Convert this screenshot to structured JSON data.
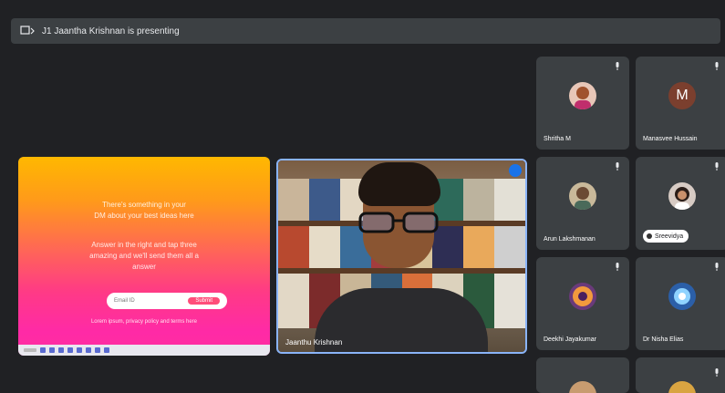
{
  "banner": {
    "text": "J1 Jaantha Krishnan is presenting"
  },
  "presentation": {
    "lines": [
      "There's something in your",
      "DM about your best ideas here",
      "Answer in the right and tap three",
      "amazing and we'll send them all a",
      "answer"
    ],
    "input_placeholder": "Email ID",
    "submit_label": "Submit",
    "footer": "Lorem ipsum, privacy policy and terms here"
  },
  "camera": {
    "name": "Jaanthu Krishnan"
  },
  "participants": [
    {
      "name": "Shritha M",
      "avatar_color": "#e8c7b8"
    },
    {
      "name": "Manasvee Hussain",
      "initial": "M",
      "avatar_color": "#7b3f2e"
    },
    {
      "name": "Arun Lakshmanan",
      "avatar_color": "#c9b99a"
    },
    {
      "name": "Sreevidya",
      "avatar_color": "#d7cbc4"
    },
    {
      "name": "Deekhi Jayakumar",
      "avatar_color": "#6a3a7a"
    },
    {
      "name": "Dr Nisha Elias",
      "avatar_color": "#2b5fa8"
    }
  ]
}
